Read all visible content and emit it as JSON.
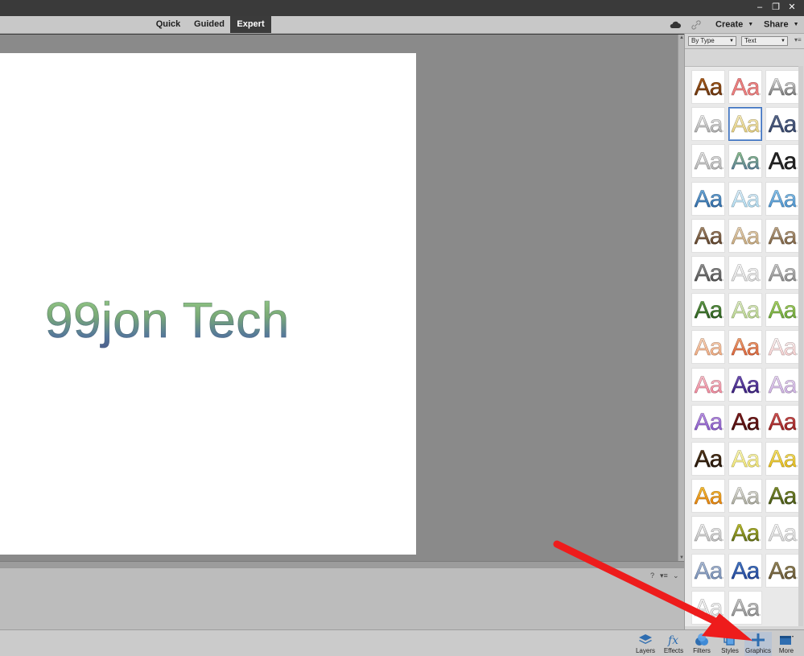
{
  "window": {
    "controls": [
      "minimize",
      "restore",
      "close"
    ],
    "control_glyphs": {
      "minimize": "–",
      "restore": "❐",
      "close": "✕"
    }
  },
  "mode_tabs": [
    {
      "label": "Quick",
      "active": false
    },
    {
      "label": "Guided",
      "active": false
    },
    {
      "label": "Expert",
      "active": true
    }
  ],
  "toolbar": {
    "create_label": "Create",
    "share_label": "Share",
    "caret": "▼"
  },
  "canvas": {
    "document_text": "99jon Tech"
  },
  "styles_panel": {
    "type_filter": "By Type",
    "category_filter": "Text",
    "menu_glyph": "▾≡",
    "swatch_label": "Aa",
    "selected_index": 4
  },
  "bin": {
    "help_glyph": "?",
    "menu_glyph": "▾≡",
    "collapse_glyph": "⌄"
  },
  "taskbar": {
    "buttons": [
      {
        "label": "Layers",
        "icon": "layers-icon"
      },
      {
        "label": "Effects",
        "icon": "fx-icon"
      },
      {
        "label": "Filters",
        "icon": "filters-icon"
      },
      {
        "label": "Styles",
        "icon": "styles-icon"
      },
      {
        "label": "Graphics",
        "icon": "plus-icon"
      },
      {
        "label": "More",
        "icon": "more-window-icon"
      }
    ]
  },
  "colors": {
    "workspace": "#8a8a8a",
    "modebar": "#c8c8c8",
    "active_tab": "#3b3b3b",
    "selection": "#3a6fbf",
    "annotation_arrow": "#ee1c1c"
  }
}
